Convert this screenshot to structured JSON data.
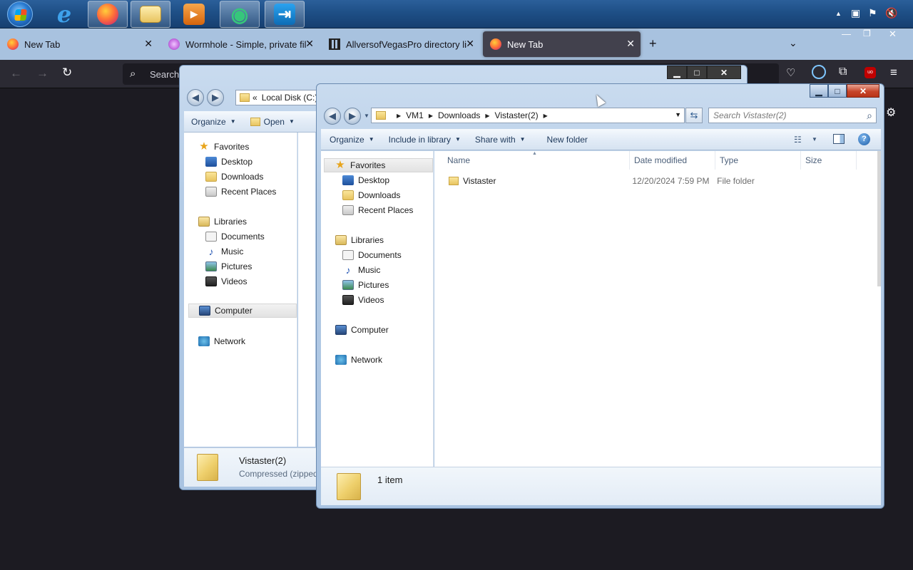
{
  "taskbar": {
    "apps": [
      {
        "name": "start-orb"
      },
      {
        "name": "internet-explorer",
        "glyph": "e",
        "color": "#2b8fe0"
      },
      {
        "name": "firefox",
        "color": "#ff7139"
      },
      {
        "name": "file-explorer",
        "color": "#e8c460"
      },
      {
        "name": "media-player",
        "glyph": "▶",
        "color": "#e87f1a"
      },
      {
        "name": "chat-app",
        "glyph": "◉",
        "color": "#2fb56a"
      },
      {
        "name": "remote-app",
        "glyph": "⇥",
        "color": "#1c8fd8"
      }
    ]
  },
  "firefox": {
    "tabs": [
      {
        "title": "New Tab",
        "favicon_color": "#ff7139"
      },
      {
        "title": "Wormhole - Simple, private file sharing",
        "favicon_color": "#c46be0"
      },
      {
        "title": "AllversofVegasPro directory listing",
        "favicon_color": "#222222"
      },
      {
        "title": "New Tab",
        "favicon_color": "#ff7139"
      }
    ],
    "new_tab_glyph": "+",
    "urlbar_placeholder": "Search or enter address"
  },
  "explorer_back": {
    "breadcrumb_prefix": "«",
    "address": "Local Disk (C:)",
    "toolbar": {
      "organize": "Organize",
      "open": "Open"
    },
    "nav": [
      {
        "label": "Favorites",
        "icon": "star"
      },
      {
        "label": "Desktop",
        "icon": "desktop"
      },
      {
        "label": "Downloads",
        "icon": "folder"
      },
      {
        "label": "Recent Places",
        "icon": "recent"
      },
      {
        "label": "Libraries",
        "icon": "library"
      },
      {
        "label": "Documents",
        "icon": "document"
      },
      {
        "label": "Music",
        "icon": "music"
      },
      {
        "label": "Pictures",
        "icon": "pictures"
      },
      {
        "label": "Videos",
        "icon": "videos"
      },
      {
        "label": "Computer",
        "icon": "computer"
      },
      {
        "label": "Network",
        "icon": "network"
      }
    ],
    "details": {
      "name": "Vistaster(2)",
      "type": "Compressed (zipped)"
    }
  },
  "explorer_front": {
    "breadcrumb": [
      "VM1",
      "Downloads",
      "Vistaster(2)"
    ],
    "search_placeholder": "Search Vistaster(2)",
    "toolbar": {
      "organize": "Organize",
      "include_in_library": "Include in library",
      "share_with": "Share with",
      "new_folder": "New folder"
    },
    "nav": [
      {
        "label": "Favorites",
        "icon": "star"
      },
      {
        "label": "Desktop",
        "icon": "desktop"
      },
      {
        "label": "Downloads",
        "icon": "folder"
      },
      {
        "label": "Recent Places",
        "icon": "recent"
      },
      {
        "label": "Libraries",
        "icon": "library"
      },
      {
        "label": "Documents",
        "icon": "document"
      },
      {
        "label": "Music",
        "icon": "music"
      },
      {
        "label": "Pictures",
        "icon": "pictures"
      },
      {
        "label": "Videos",
        "icon": "videos"
      },
      {
        "label": "Computer",
        "icon": "computer"
      },
      {
        "label": "Network",
        "icon": "network"
      }
    ],
    "columns": [
      "Name",
      "Date modified",
      "Type",
      "Size"
    ],
    "files": [
      {
        "name": "Vistaster",
        "date_modified": "12/20/2024 7:59 PM",
        "type": "File folder",
        "size": ""
      }
    ],
    "status": "1 item"
  }
}
